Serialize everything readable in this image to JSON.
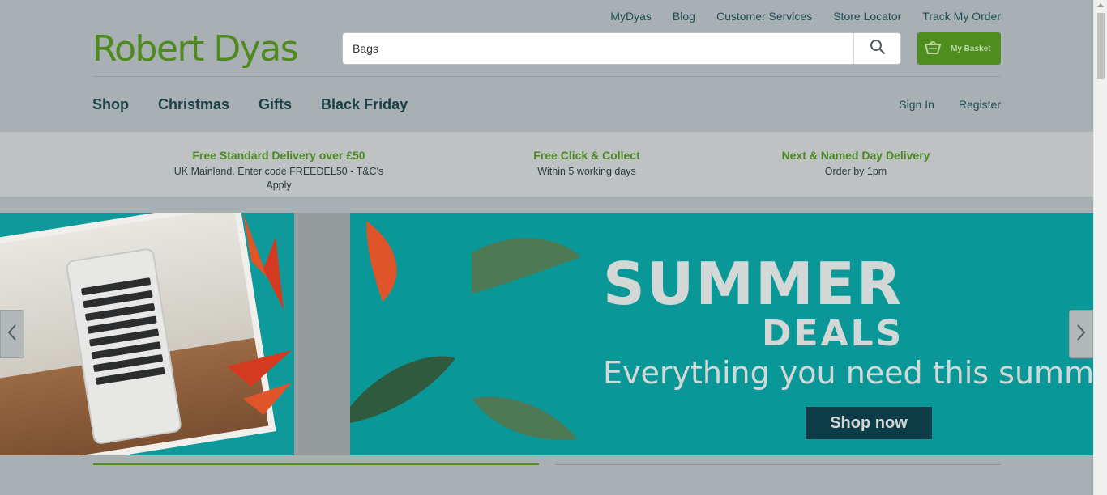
{
  "header": {
    "logo": "Robert Dyas",
    "top_links": [
      "MyDyas",
      "Blog",
      "Customer Services",
      "Store Locator",
      "Track My Order"
    ],
    "search": {
      "value": "Bags",
      "icon": "search-icon"
    },
    "basket": {
      "label": "My Basket",
      "icon": "basket-icon"
    },
    "main_nav": [
      "Shop",
      "Christmas",
      "Gifts",
      "Black Friday"
    ],
    "account": {
      "sign_in": "Sign In",
      "register": "Register"
    }
  },
  "usp": [
    {
      "title": "Free Standard Delivery over £50",
      "subtitle": "UK Mainland. Enter code FREEDEL50 - T&C's Apply"
    },
    {
      "title": "Free Click & Collect",
      "subtitle": "Within 5 working days"
    },
    {
      "title": "Next & Named Day Delivery",
      "subtitle": "Order by 1pm"
    }
  ],
  "banner": {
    "headline": "SUMMER",
    "subheadline": "DEALS",
    "tagline": "Everything you need this summ",
    "cta": "Shop now",
    "prev_icon": "chevron-left-icon",
    "next_icon": "chevron-right-icon"
  },
  "colors": {
    "brand_green": "#4f8d1f",
    "nav_text": "#1b3f47",
    "banner_teal": "#0a9797",
    "cta_bg": "#0d3b47"
  }
}
